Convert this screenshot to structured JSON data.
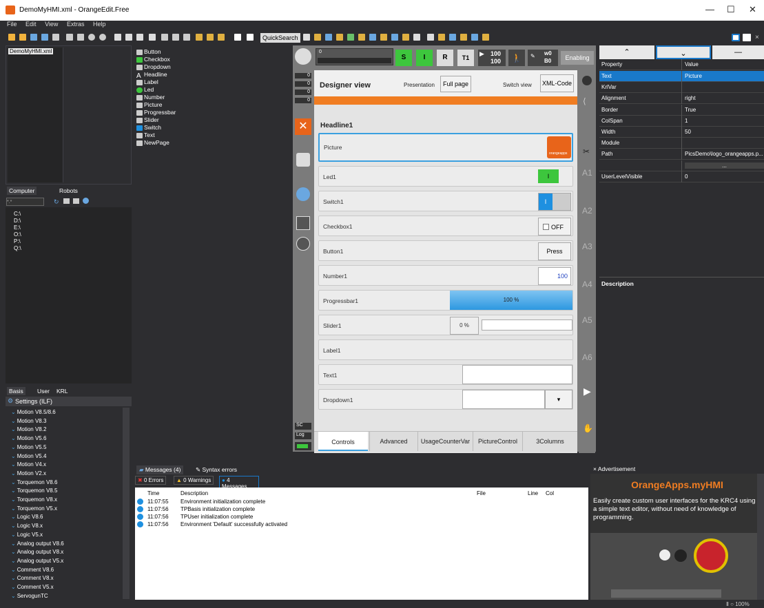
{
  "window": {
    "title": "DemoMyHMI.xml - OrangeEdit.Free",
    "minimize": "—",
    "maximize": "☐",
    "close": "✕"
  },
  "menu": [
    "File",
    "Edit",
    "View",
    "Extras",
    "Help"
  ],
  "toolbar": {
    "quicksearch_label": "QuickSearch"
  },
  "file_tree": {
    "root": "DemoMyHMI.xml"
  },
  "explorer": {
    "tabs": [
      "Computer",
      "Robots"
    ],
    "drives": [
      "C:\\",
      "D:\\",
      "E:\\",
      "O:\\",
      "P:\\",
      "Q:\\"
    ],
    "path_input": "*.*"
  },
  "snippets": {
    "tabs": [
      "Basis",
      "User",
      "KRL"
    ],
    "settings_label": "Settings (ILF)",
    "items": [
      "Motion V8.5/8.6",
      "Motion V8.3",
      "Motion V8.2",
      "Motion V5.6",
      "Motion V5.5",
      "Motion V5.4",
      "Motion V4.x",
      "Motion V2.x",
      "Torquemon V8.6",
      "Torquemon V8.5",
      "Torquemon V8.x",
      "Torquemon V5.x",
      "Logic V8.6",
      "Logic V8.x",
      "Logic V5.x",
      "Analog output V8.6",
      "Analog output V8.x",
      "Analog output V5.x",
      "Comment V8.6",
      "Comment V8.x",
      "Comment V5.x",
      "ServogunTC"
    ]
  },
  "toolbox": {
    "items": [
      "Button",
      "Checkbox",
      "Dropdown",
      "Headline",
      "Label",
      "Led",
      "Number",
      "Picture",
      "Progressbar",
      "Slider",
      "Switch",
      "Text",
      "NewPage"
    ]
  },
  "pendant": {
    "status": {
      "field": "0",
      "s": "S",
      "i": "I",
      "r": "R",
      "t1": "T1",
      "speed1": "100",
      "speed2": "100",
      "w": "w0",
      "b": "B0",
      "enabling": "Enabling"
    },
    "side_indicators": [
      "0",
      "0",
      "0",
      "0"
    ],
    "axis_labels": [
      "A1",
      "A2",
      "A3",
      "A4",
      "A5",
      "A6"
    ],
    "sc_label": "SC",
    "log_label": "Log"
  },
  "designer": {
    "title": "Designer view",
    "presentation_label": "Presentation",
    "fullpage_button": "Full page",
    "switchview_label": "Switch view",
    "xmlcode_button": "XML-Code",
    "headline": "Headline1",
    "picture_label": "Picture",
    "picture_logo_text": "orangeapps",
    "led_label": "Led1",
    "led_value": "I",
    "switch_label": "Switch1",
    "switch_value": "I",
    "checkbox_label": "Checkbox1",
    "checkbox_value": "OFF",
    "button_label": "Button1",
    "button_text": "Press",
    "number_label": "Number1",
    "number_value": "100",
    "progress_label": "Progressbar1",
    "progress_value": "100 %",
    "progress_fraction": 1.0,
    "slider_label": "Slider1",
    "slider_value": "0 %",
    "label_label": "Label1",
    "text_label": "Text1",
    "text_value": "",
    "dropdown_label": "Dropdown1",
    "dropdown_value": "",
    "tabs": [
      "Controls",
      "Advanced",
      "UsageCounterVar",
      "PictureControl",
      "3Columns"
    ]
  },
  "properties": {
    "header_property": "Property",
    "header_value": "Value",
    "rows": [
      {
        "k": "Text",
        "v": "Picture"
      },
      {
        "k": "KrlVar",
        "v": ""
      },
      {
        "k": "Alignment",
        "v": "right"
      },
      {
        "k": "Border",
        "v": "True"
      },
      {
        "k": "ColSpan",
        "v": "1"
      },
      {
        "k": "Width",
        "v": "50"
      },
      {
        "k": "Module",
        "v": ""
      },
      {
        "k": "Path",
        "v": "PicsDemo\\logo_orangeapps.p..."
      },
      {
        "k": "",
        "v": "..."
      },
      {
        "k": "UserLevelVisible",
        "v": "0"
      }
    ],
    "description_label": "Description"
  },
  "messages": {
    "tab_label": "Messages (4)",
    "syntax_tab": "Syntax errors",
    "errors": "0 Errors",
    "warnings": "0 Warnings",
    "messages": "4 Messages",
    "columns": [
      "Time",
      "Description",
      "File",
      "Line",
      "Col"
    ],
    "rows": [
      {
        "time": "11:07:55",
        "desc": "Environment initialization complete"
      },
      {
        "time": "11:07:56",
        "desc": "TPBasis initialization complete"
      },
      {
        "time": "11:07:56",
        "desc": "TPUser initialization complete"
      },
      {
        "time": "11:07:56",
        "desc": "Environment 'Default' successfully activated"
      }
    ]
  },
  "advertisement": {
    "tab": "Advertisement",
    "title": "OrangeApps.myHMI",
    "text": "Easily create custom user interfaces for the KRC4 using a simple text editor, without need of knowledge of programming."
  },
  "statusbar": {
    "zoom": "100%"
  },
  "colors": {
    "accent": "#e8641a",
    "green": "#3dc63d",
    "blue": "#1e90e0",
    "selection": "#1979ca"
  }
}
